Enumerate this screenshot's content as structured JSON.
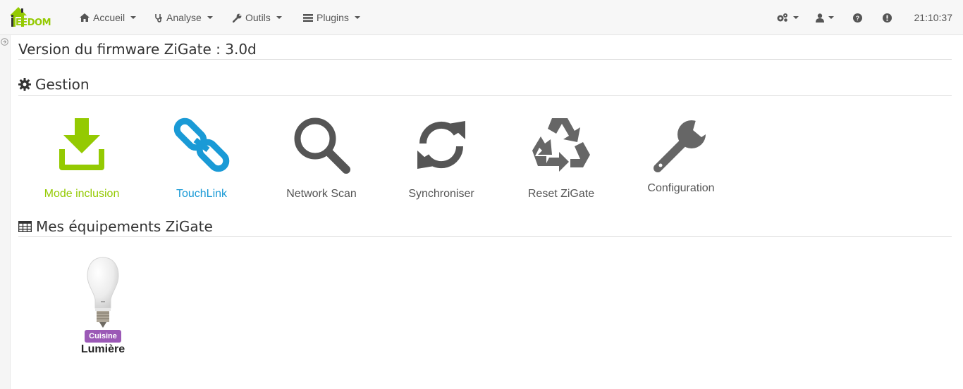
{
  "app": {
    "logo_text": "EEDOM"
  },
  "nav": {
    "accueil": "Accueil",
    "analyse": "Analyse",
    "outils": "Outils",
    "plugins": "Plugins",
    "time": "21:10:37"
  },
  "firmware": {
    "text": "Version du firmware ZiGate : 3.0d"
  },
  "gestion": {
    "title": "Gestion",
    "items": [
      {
        "label": "Mode inclusion",
        "color": "#94ca02",
        "icon": "download-icon"
      },
      {
        "label": "TouchLink",
        "color": "#1a9ad6",
        "icon": "link-icon"
      },
      {
        "label": "Network Scan",
        "color": "#555555",
        "icon": "search-icon"
      },
      {
        "label": "Synchroniser",
        "color": "#555555",
        "icon": "refresh-icon"
      },
      {
        "label": "Reset ZiGate",
        "color": "#555555",
        "icon": "recycle-icon"
      },
      {
        "label": "Configuration",
        "color": "#555555",
        "icon": "wrench-icon"
      }
    ]
  },
  "equipements": {
    "title": "Mes équipements ZiGate",
    "items": [
      {
        "room": "Cuisine",
        "name": "Lumière",
        "room_color": "#9b59b6",
        "icon": "light-bulb-icon"
      }
    ]
  }
}
